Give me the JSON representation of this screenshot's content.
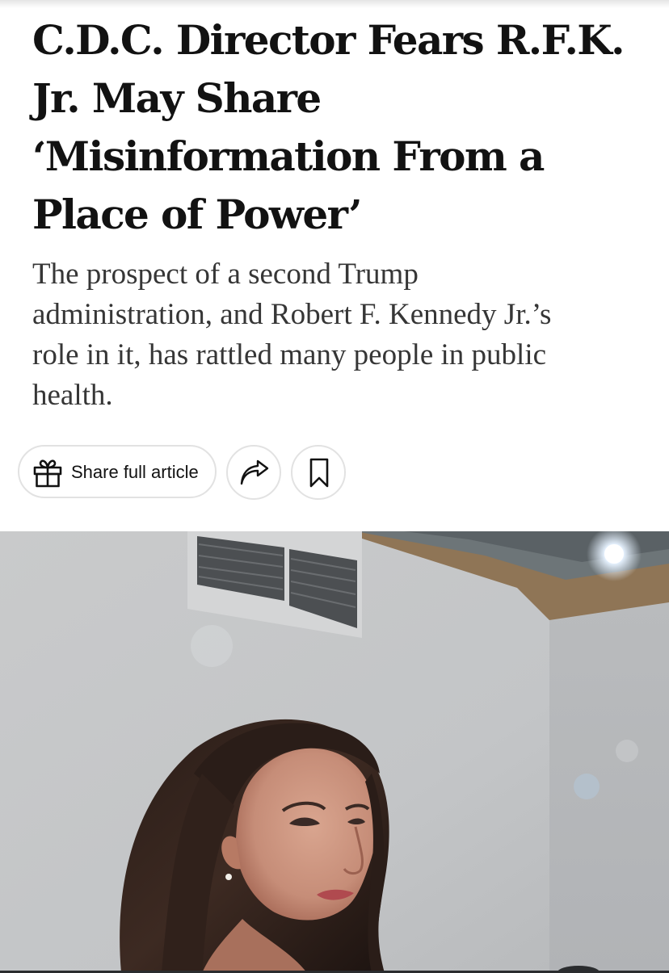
{
  "article": {
    "headline_lines": [
      "C.D.C. Director Fears R.F.K.",
      "Jr. May Share",
      "‘Misinformation From a",
      "Place of Power’"
    ],
    "summary_lines": [
      "The prospect of a second Trump",
      "administration, and Robert F. Kennedy Jr.’s",
      "role in it, has rattled many people in public",
      "health."
    ]
  },
  "actions": {
    "share_label": "Share full article",
    "share_icon": "gift-icon",
    "forward_icon": "share-arrow-icon",
    "save_icon": "bookmark-icon"
  },
  "photo": {
    "subject": "lead-photo-woman-portrait"
  }
}
